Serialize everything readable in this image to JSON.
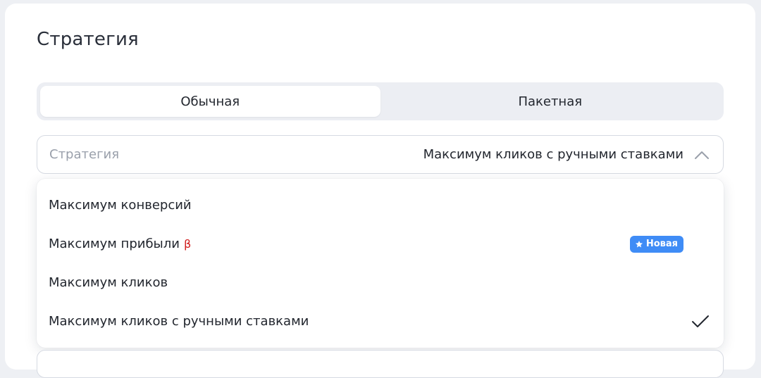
{
  "card": {
    "title": "Стратегия"
  },
  "tabs": [
    {
      "label": "Обычная",
      "active": true
    },
    {
      "label": "Пакетная",
      "active": false
    }
  ],
  "strategy_select": {
    "label": "Стратегия",
    "value": "Максимум кликов с ручными ставками",
    "icon": "chevron-up-icon"
  },
  "dropdown": {
    "options": [
      {
        "label": "Максимум конверсий"
      },
      {
        "label": "Максимум прибыли",
        "beta": "β",
        "badge": "Новая",
        "badge_icon": "star-icon"
      },
      {
        "label": "Максимум кликов"
      },
      {
        "label": "Максимум кликов с ручными ставками",
        "selected": true,
        "icon": "check-icon"
      }
    ]
  },
  "colors": {
    "accent": "#3f8cf6",
    "beta": "#d01a1a"
  }
}
